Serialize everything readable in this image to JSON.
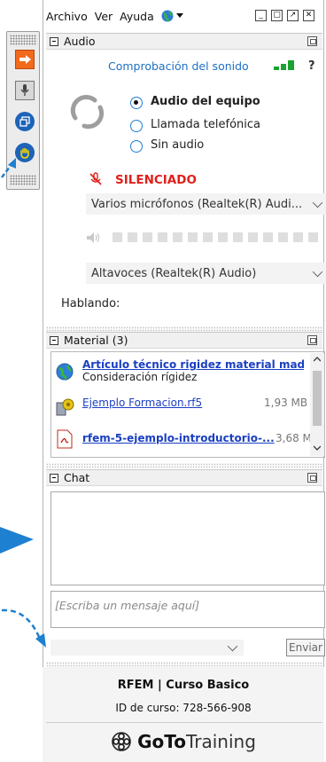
{
  "menu": {
    "items": [
      "Archivo",
      "Ver",
      "Ayuda"
    ]
  },
  "audio": {
    "title": "Audio",
    "sound_check": "Comprobación del sonido",
    "help_glyph": "?",
    "options": [
      {
        "label": "Audio del equipo",
        "selected": true
      },
      {
        "label": "Llamada telefónica",
        "selected": false
      },
      {
        "label": "Sin audio",
        "selected": false
      }
    ],
    "muted_label": "SILENCIADO",
    "microphone": "Varios micrófonos (Realtek(R) Audi...",
    "speakers": "Altavoces (Realtek(R) Audio)",
    "speaking_label": "Hablando:"
  },
  "material": {
    "title": "Material (3)",
    "items": [
      {
        "name": "Artículo técnico rigidez material madera",
        "subtitle": "Consideración rígidez",
        "size": ""
      },
      {
        "name": "Ejemplo Formacion.rf5",
        "subtitle": "",
        "size": "1,93 MB"
      },
      {
        "name": "rfem-5-ejemplo-introductorio-...",
        "subtitle": "",
        "size": "3,68 MB"
      }
    ]
  },
  "chat": {
    "title": "Chat",
    "placeholder": "[Escriba un mensaje aquí]",
    "send_label": "Enviar"
  },
  "course": {
    "name": "RFEM | Curso Basico",
    "id_label": "ID de curso: 728-566-908"
  },
  "brand": {
    "goto": "GoTo",
    "training": "Training"
  },
  "colors": {
    "accent": "#1e7fd6",
    "muted": "#e0201b",
    "link": "#1a3fc2",
    "level_green": "#1aa330"
  }
}
